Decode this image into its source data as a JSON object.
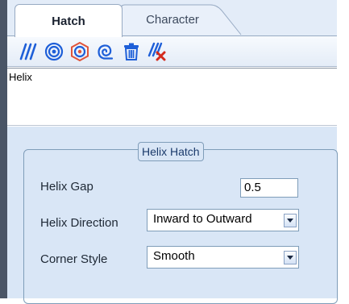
{
  "tabs": [
    {
      "label": "Hatch",
      "active": true
    },
    {
      "label": "Character",
      "active": false
    }
  ],
  "toolbar": {
    "buttons": [
      {
        "icon": "hatch-lines-icon"
      },
      {
        "icon": "hatch-concentric-icon"
      },
      {
        "icon": "hatch-offset-icon"
      },
      {
        "icon": "helix-icon"
      },
      {
        "icon": "delete-icon"
      },
      {
        "icon": "remove-hatch-icon"
      }
    ]
  },
  "list": {
    "items": [
      "Helix"
    ]
  },
  "group": {
    "title": "Helix Hatch"
  },
  "fields": {
    "helix_gap": {
      "label": "Helix Gap",
      "value": "0.5"
    },
    "helix_direction": {
      "label": "Helix Direction",
      "value": "Inward to Outward"
    },
    "corner_style": {
      "label": "Corner Style",
      "value": "Smooth"
    }
  },
  "colors": {
    "accent": "#1e5fd8",
    "panel": "#d9e6f6",
    "delete_red": "#d42a1c"
  }
}
